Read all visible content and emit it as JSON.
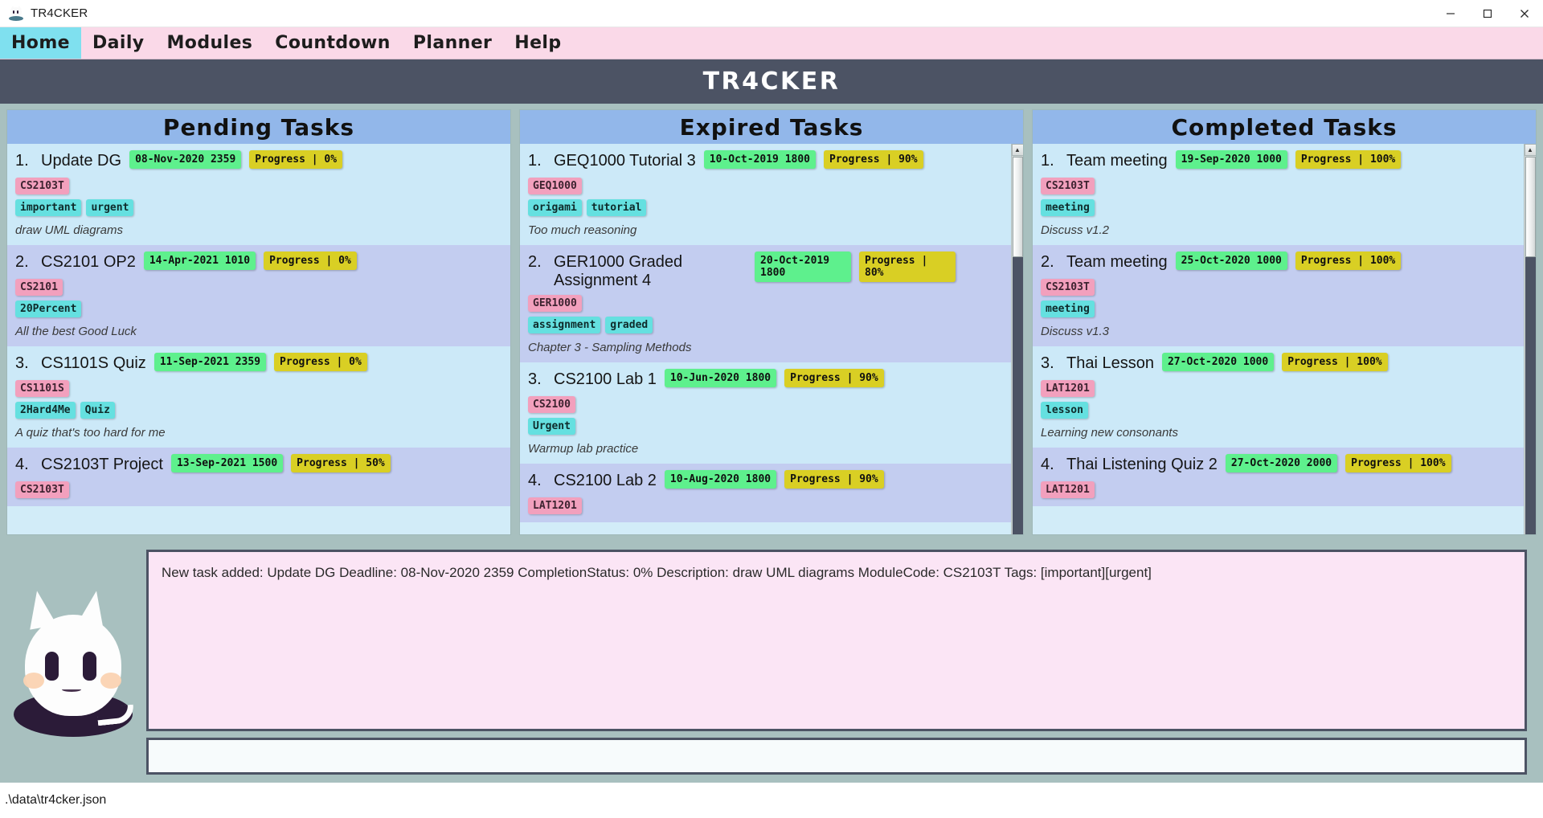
{
  "window": {
    "title": "TR4CKER",
    "app_icon": "cat-icon",
    "minimize_label": "Minimize",
    "maximize_label": "Maximize",
    "close_label": "Close"
  },
  "menu": {
    "items": [
      {
        "label": "Home",
        "active": true
      },
      {
        "label": "Daily",
        "active": false
      },
      {
        "label": "Modules",
        "active": false
      },
      {
        "label": "Countdown",
        "active": false
      },
      {
        "label": "Planner",
        "active": false
      },
      {
        "label": "Help",
        "active": false
      }
    ]
  },
  "banner": {
    "title": "TR4CKER"
  },
  "colors": {
    "menu_bg": "#fad9e8",
    "menu_active": "#7fe0ef",
    "banner_bg": "#4c5364",
    "panel_header": "#92b7ea",
    "panel_bg_even": "#cce9f8",
    "panel_bg_odd": "#c3cdf0",
    "deadline_pill": "#5ef08d",
    "progress_pill": "#d9cf24",
    "module_tag": "#f2a0bd",
    "label_tag": "#65e0e0",
    "app_bg": "#a8c0bf",
    "log_bg": "#fbe5f5"
  },
  "panels": [
    {
      "title": "Pending Tasks",
      "scrollbar": {
        "visible": false
      },
      "tasks": [
        {
          "num": "1.",
          "title": "Update DG",
          "deadline": "08-Nov-2020 2359",
          "progress": "Progress | 0%",
          "module": "CS2103T",
          "tags": [
            "important",
            "urgent"
          ],
          "description": "draw UML diagrams"
        },
        {
          "num": "2.",
          "title": "CS2101 OP2",
          "deadline": "14-Apr-2021 1010",
          "progress": "Progress | 0%",
          "module": "CS2101",
          "tags": [
            "20Percent"
          ],
          "description": "All the best Good Luck"
        },
        {
          "num": "3.",
          "title": "CS1101S Quiz",
          "deadline": "11-Sep-2021 2359",
          "progress": "Progress | 0%",
          "module": "CS1101S",
          "tags": [
            "2Hard4Me",
            "Quiz"
          ],
          "description": "A quiz that's too hard for me"
        },
        {
          "num": "4.",
          "title": "CS2103T Project",
          "deadline": "13-Sep-2021 1500",
          "progress": "Progress | 50%",
          "module": "CS2103T",
          "tags": [],
          "description": ""
        }
      ]
    },
    {
      "title": "Expired Tasks",
      "scrollbar": {
        "visible": true
      },
      "tasks": [
        {
          "num": "1.",
          "title": "GEQ1000 Tutorial 3",
          "deadline": "10-Oct-2019 1800",
          "progress": "Progress | 90%",
          "module": "GEQ1000",
          "tags": [
            "origami",
            "tutorial"
          ],
          "description": "Too much reasoning"
        },
        {
          "num": "2.",
          "title": "GER1000 Graded Assignment 4",
          "deadline": "20-Oct-2019 1800",
          "progress": "Progress | 80%",
          "module": "GER1000",
          "tags": [
            "assignment",
            "graded"
          ],
          "description": "Chapter 3 - Sampling Methods",
          "wrap": true
        },
        {
          "num": "3.",
          "title": "CS2100 Lab 1",
          "deadline": "10-Jun-2020 1800",
          "progress": "Progress | 90%",
          "module": "CS2100",
          "tags": [
            "Urgent"
          ],
          "description": "Warmup lab practice"
        },
        {
          "num": "4.",
          "title": "CS2100 Lab 2",
          "deadline": "10-Aug-2020 1800",
          "progress": "Progress | 90%",
          "module": "LAT1201",
          "tags": [],
          "description": ""
        }
      ]
    },
    {
      "title": "Completed Tasks",
      "scrollbar": {
        "visible": true
      },
      "tasks": [
        {
          "num": "1.",
          "title": "Team meeting",
          "deadline": "19-Sep-2020 1000",
          "progress": "Progress | 100%",
          "module": "CS2103T",
          "tags": [
            "meeting"
          ],
          "description": "Discuss v1.2"
        },
        {
          "num": "2.",
          "title": "Team meeting",
          "deadline": "25-Oct-2020 1000",
          "progress": "Progress | 100%",
          "module": "CS2103T",
          "tags": [
            "meeting"
          ],
          "description": "Discuss v1.3"
        },
        {
          "num": "3.",
          "title": "Thai Lesson",
          "deadline": "27-Oct-2020 1000",
          "progress": "Progress | 100%",
          "module": "LAT1201",
          "tags": [
            "lesson"
          ],
          "description": "Learning new consonants"
        },
        {
          "num": "4.",
          "title": "Thai Listening Quiz 2",
          "deadline": "27-Oct-2020 2000",
          "progress": "Progress | 100%",
          "module": "LAT1201",
          "tags": [],
          "description": ""
        }
      ]
    }
  ],
  "mascot": {
    "name": "cat-mascot"
  },
  "log": {
    "message": "New task added: Update DG Deadline: 08-Nov-2020 2359 CompletionStatus: 0% Description: draw UML diagrams ModuleCode: CS2103T Tags: [important][urgent]"
  },
  "command": {
    "value": "",
    "placeholder": ""
  },
  "statusbar": {
    "path": ".\\data\\tr4cker.json"
  }
}
